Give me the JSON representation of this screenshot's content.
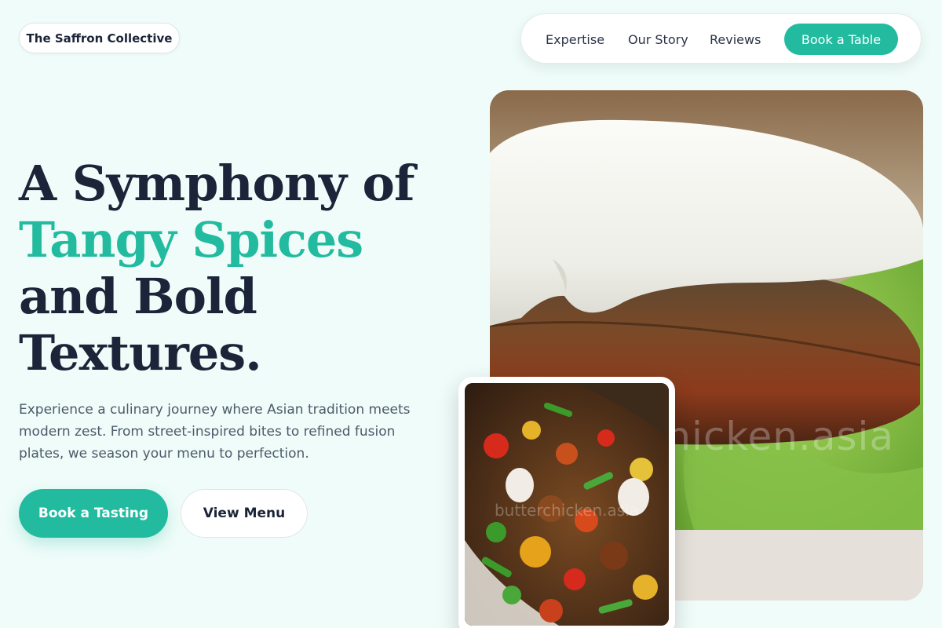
{
  "brand": {
    "name": "The Saffron Collective"
  },
  "nav": {
    "links": [
      "Expertise",
      "Our Story",
      "Reviews"
    ],
    "cta": "Book a Table"
  },
  "hero": {
    "headline_line1": "A Symphony of",
    "headline_accent": "Tangy Spices",
    "headline_line3": "and Bold",
    "headline_line4": "Textures.",
    "description": "Experience a culinary journey where Asian tradition meets modern zest. From street-inspired bites to refined fusion plates, we season your menu to perfection.",
    "primary_cta": "Book a Tasting",
    "secondary_cta": "View Menu"
  },
  "images": {
    "main_alt": "bao burger",
    "main_watermark": "butterchicken.asia",
    "inset_alt": "stir fry",
    "inset_watermark": "butterchicken.asia"
  },
  "colors": {
    "background": "#effcf9",
    "accent": "#22bb9f",
    "heading": "#1b2438"
  }
}
